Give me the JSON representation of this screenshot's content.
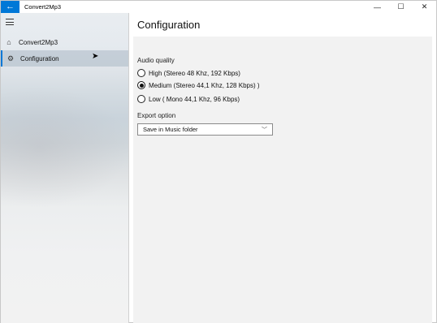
{
  "window": {
    "title": "Convert2Mp3",
    "back_glyph": "←",
    "controls": {
      "minimize": "—",
      "maximize": "☐",
      "close": "✕"
    },
    "accent": "#0078d7"
  },
  "sidebar": {
    "menu_icon": "hamburger-icon",
    "items": [
      {
        "label": "Convert2Mp3",
        "icon": "home-icon",
        "glyph": "⌂",
        "selected": false
      },
      {
        "label": "Configuration",
        "icon": "gear-icon",
        "glyph": "⚙",
        "selected": true
      }
    ]
  },
  "main": {
    "title": "Configuration",
    "audio_quality": {
      "label": "Audio quality",
      "options": [
        {
          "label": "High (Stereo 48 Khz, 192 Kbps)",
          "checked": false
        },
        {
          "label": "Medium  (Stereo 44,1 Khz, 128 Kbps)  )",
          "checked": true
        },
        {
          "label": "Low ( Mono 44,1 Khz, 96 Kbps)",
          "checked": false
        }
      ]
    },
    "export_option": {
      "label": "Export option",
      "selected": "Save in Music folder",
      "chevron": "﹀"
    }
  }
}
